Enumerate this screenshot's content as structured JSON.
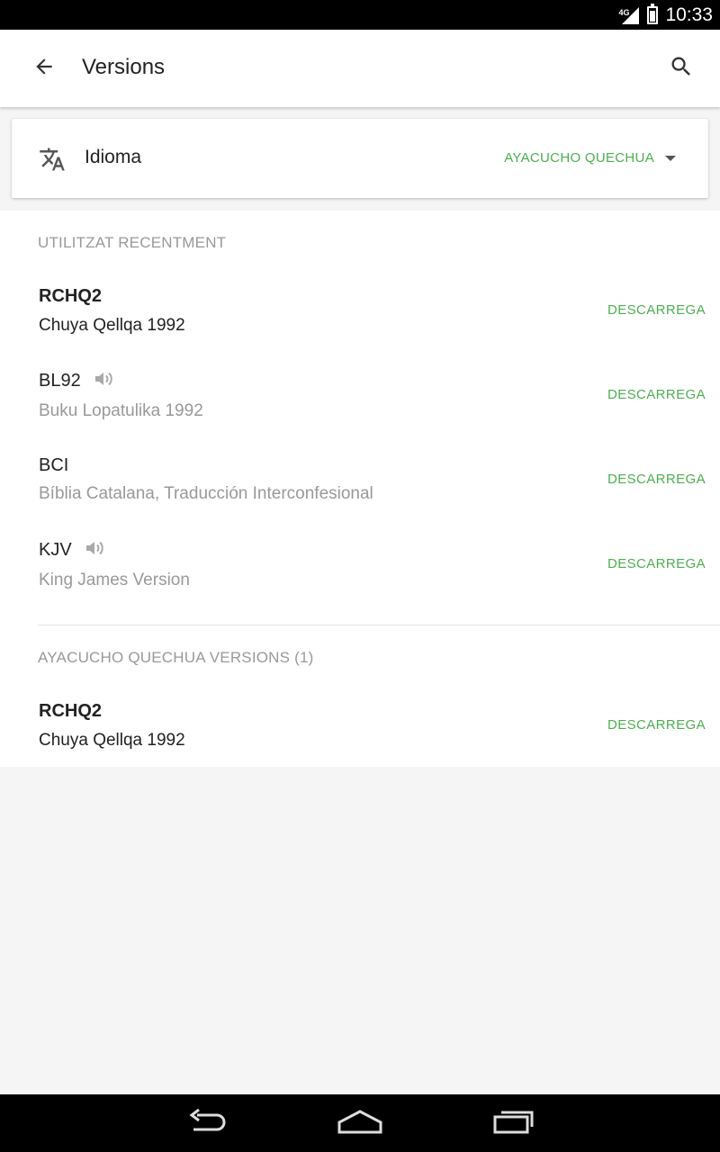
{
  "status_bar": {
    "network": "4G",
    "time": "10:33"
  },
  "app_bar": {
    "title": "Versions",
    "back_icon": "arrow-back-icon",
    "search_icon": "search-icon"
  },
  "language": {
    "label": "Idioma",
    "selected": "AYACUCHO QUECHUA",
    "icon": "translate-icon"
  },
  "recent": {
    "header": "UTILITZAT RECENTMENT",
    "items": [
      {
        "abbr": "RCHQ2",
        "name": "Chuya Qellqa 1992",
        "action": "DESCARREGA",
        "audio": false
      },
      {
        "abbr": "BL92",
        "name": "Buku Lopatulika 1992",
        "action": "DESCARREGA",
        "audio": true
      },
      {
        "abbr": "BCI",
        "name": "Bíblia Catalana, Traducción Interconfesional",
        "action": "DESCARREGA",
        "audio": false
      },
      {
        "abbr": "KJV",
        "name": "King James Version",
        "action": "DESCARREGA",
        "audio": true
      }
    ]
  },
  "language_versions": {
    "header": "AYACUCHO QUECHUA VERSIONS (1)",
    "items": [
      {
        "abbr": "RCHQ2",
        "name": "Chuya Qellqa 1992",
        "action": "DESCARREGA"
      }
    ]
  },
  "colors": {
    "accent": "#4caf50",
    "text_primary": "#222222",
    "text_secondary": "#999999",
    "background": "#f5f5f5"
  },
  "nav_bar": {
    "back_icon": "nav-back-icon",
    "home_icon": "nav-home-icon",
    "recents_icon": "nav-recents-icon"
  }
}
